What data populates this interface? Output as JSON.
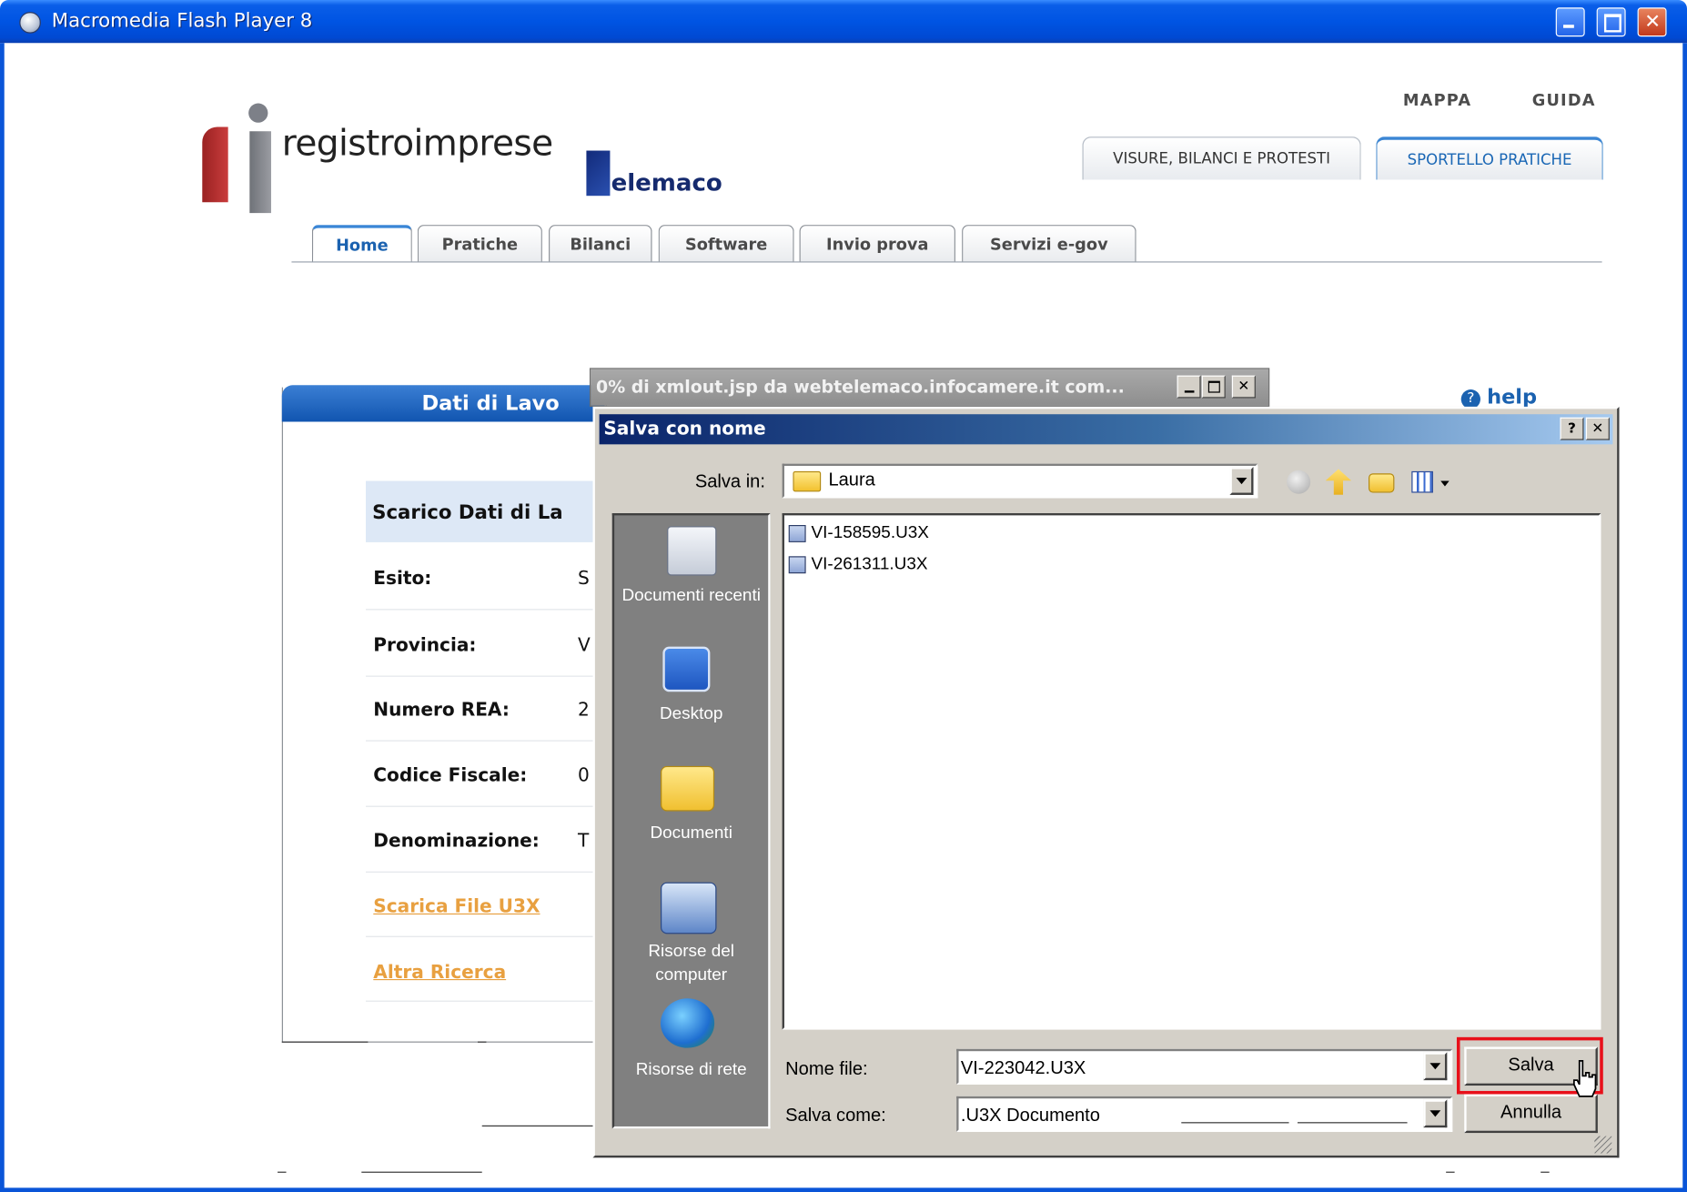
{
  "window": {
    "title": "Macromedia Flash Player 8",
    "buttons": {
      "minimize": "_",
      "maximize": "□",
      "close": "✕"
    }
  },
  "site": {
    "toplinks": [
      "MAPPA",
      "GUIDA"
    ],
    "logo": {
      "name": "registroimprese",
      "brand": "elemaco"
    },
    "section_tabs": [
      "VISURE, BILANCI E PROTESTI",
      "SPORTELLO PRATICHE"
    ],
    "nav_tabs": [
      "Home",
      "Pratiche",
      "Bilanci",
      "Software",
      "Invio prova",
      "Servizi e-gov"
    ],
    "help": "help"
  },
  "panel": {
    "header": "Dati di Lavo",
    "scarico": "Scarico Dati di La",
    "rows": [
      {
        "label": "Esito:",
        "value": "S"
      },
      {
        "label": "Provincia:",
        "value": "V"
      },
      {
        "label": "Numero REA:",
        "value": "2"
      },
      {
        "label": "Codice Fiscale:",
        "value": "0"
      },
      {
        "label": "Denominazione:",
        "value": "T"
      }
    ],
    "links": [
      "Scarica File U3X",
      "Altra Ricerca"
    ]
  },
  "download_window": {
    "title": "0% di xmlout.jsp da webtelemaco.infocamere.it com..."
  },
  "save_dialog": {
    "title": "Salva con nome",
    "help_button": "?",
    "close_button": "✕",
    "save_in_label": "Salva in:",
    "save_in_value": "Laura",
    "places": [
      "Documenti recenti",
      "Desktop",
      "Documenti",
      "Risorse del computer",
      "Risorse di rete"
    ],
    "files": [
      "VI-158595.U3X",
      "VI-261311.U3X"
    ],
    "filename_label": "Nome file:",
    "filename_value": "VI-223042.U3X",
    "savetype_label": "Salva come:",
    "savetype_value": ".U3X Documento",
    "save_button": "Salva",
    "cancel_button": "Annulla"
  },
  "colors": {
    "xp_title": "#0054e3",
    "panel_header": "#1155b0",
    "link_orange": "#e8a040",
    "dialog_face": "#d4d0c8",
    "highlight": "#e8101a"
  }
}
